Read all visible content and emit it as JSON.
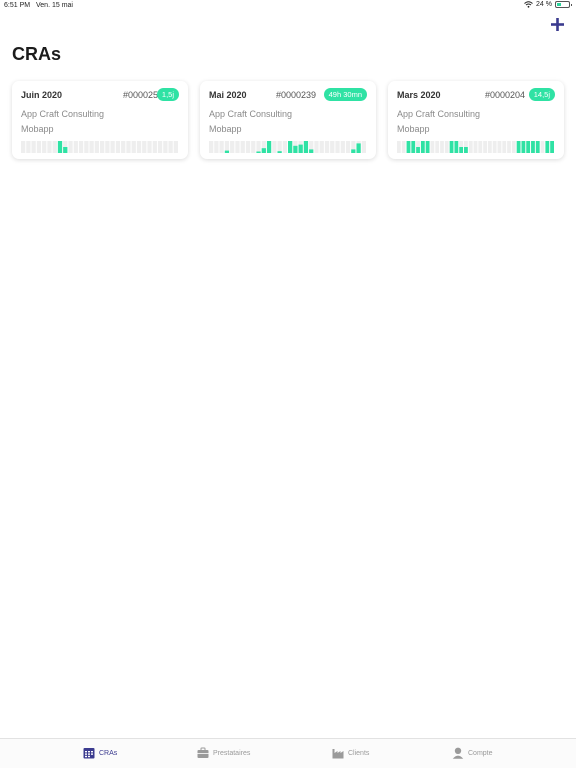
{
  "status_bar": {
    "time": "6:51 PM",
    "date": "Ven. 15 mai",
    "battery_percent": "24 %",
    "battery_level": 0.24
  },
  "header": {
    "title": "CRAs",
    "add_icon": "plus-icon"
  },
  "cards": [
    {
      "month": "Juin 2020",
      "ref": "#0000253",
      "badge": "1,5j",
      "client": "App Craft Consulting",
      "project": "Mobapp",
      "days": [
        0,
        0,
        0,
        0,
        0,
        0,
        0,
        1,
        0.5,
        0,
        0,
        0,
        0,
        0,
        0,
        0,
        0,
        0,
        0,
        0,
        0,
        0,
        0,
        0,
        0,
        0,
        0,
        0,
        0,
        0
      ]
    },
    {
      "month": "Mai 2020",
      "ref": "#0000239",
      "badge": "49h 30mn",
      "client": "App Craft Consulting",
      "project": "Mobapp",
      "days": [
        0,
        0,
        0,
        0.2,
        0,
        0,
        0,
        0,
        0,
        0.1,
        0.4,
        1,
        0,
        0.15,
        0,
        1,
        0.6,
        0.7,
        1,
        0.3,
        0,
        0,
        0,
        0,
        0,
        0,
        0,
        0.3,
        0.8,
        0
      ]
    },
    {
      "month": "Mars 2020",
      "ref": "#0000204",
      "badge": "14,5j",
      "client": "App Craft Consulting",
      "project": "Mobapp",
      "days": [
        0,
        0,
        1,
        1,
        0.5,
        1,
        1,
        0,
        0,
        0,
        0,
        1,
        1,
        0.5,
        0.5,
        0,
        0,
        0,
        0,
        0,
        0,
        0,
        0,
        0,
        0,
        1,
        1,
        1,
        1,
        1,
        0,
        1,
        1
      ]
    }
  ],
  "tabs": [
    {
      "label": "CRAs",
      "icon": "calendar-icon",
      "active": true
    },
    {
      "label": "Prestataires",
      "icon": "briefcase-icon",
      "active": false
    },
    {
      "label": "Clients",
      "icon": "factory-icon",
      "active": false
    },
    {
      "label": "Compte",
      "icon": "user-icon",
      "active": false
    }
  ],
  "colors": {
    "accent": "#3b3b8f",
    "badge": "#2fe2a4",
    "bar_active": "#2fe2a4",
    "bar_empty": "#eeeeee"
  }
}
